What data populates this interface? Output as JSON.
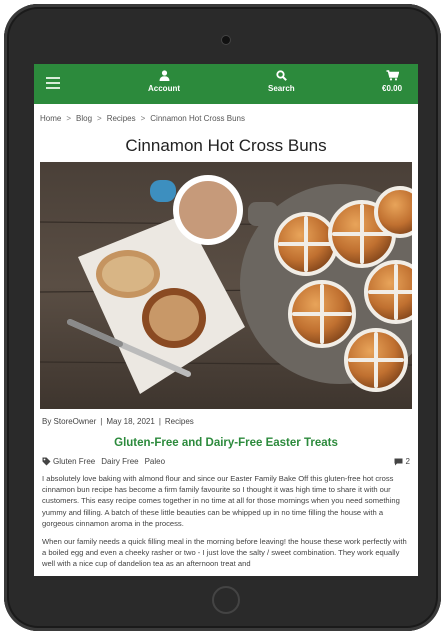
{
  "navbar": {
    "account_label": "Account",
    "search_label": "Search",
    "cart_label": "€0.00"
  },
  "breadcrumb": [
    "Home",
    "Blog",
    "Recipes",
    "Cinnamon Hot Cross Buns"
  ],
  "breadcrumb_separator": ">",
  "page_title": "Cinnamon Hot Cross Buns",
  "meta": {
    "author": "By StoreOwner",
    "divider": "|",
    "date": "May 18, 2021",
    "category": "Recipes"
  },
  "post_heading": "Gluten-Free and Dairy-Free Easter Treats",
  "tags": [
    "Gluten Free",
    "Dairy Free",
    "Paleo"
  ],
  "comment_count": "2",
  "paragraphs": [
    "I absolutely love baking with almond flour and since our Easter Family Bake Off this gluten-free hot cross cinnamon bun recipe has become a firm family favourite so I thought it was high time to share it with our customers. This easy recipe comes together in no time at all for those mornings when you need something yummy and filling. A batch of these little beauties can be whipped up in no time filling the house with a gorgeous cinnamon aroma in the process.",
    "When our family needs a quick filling meal in the morning before leaving! the house these work perfectly with a boiled egg and even a cheeky rasher or two - I just love the salty / sweet combination. They work equally well with a nice cup of dandelion tea as an afternoon treat and"
  ],
  "colors": {
    "brand_green": "#2c8a3c",
    "device_frame": "#2a2a2a"
  }
}
